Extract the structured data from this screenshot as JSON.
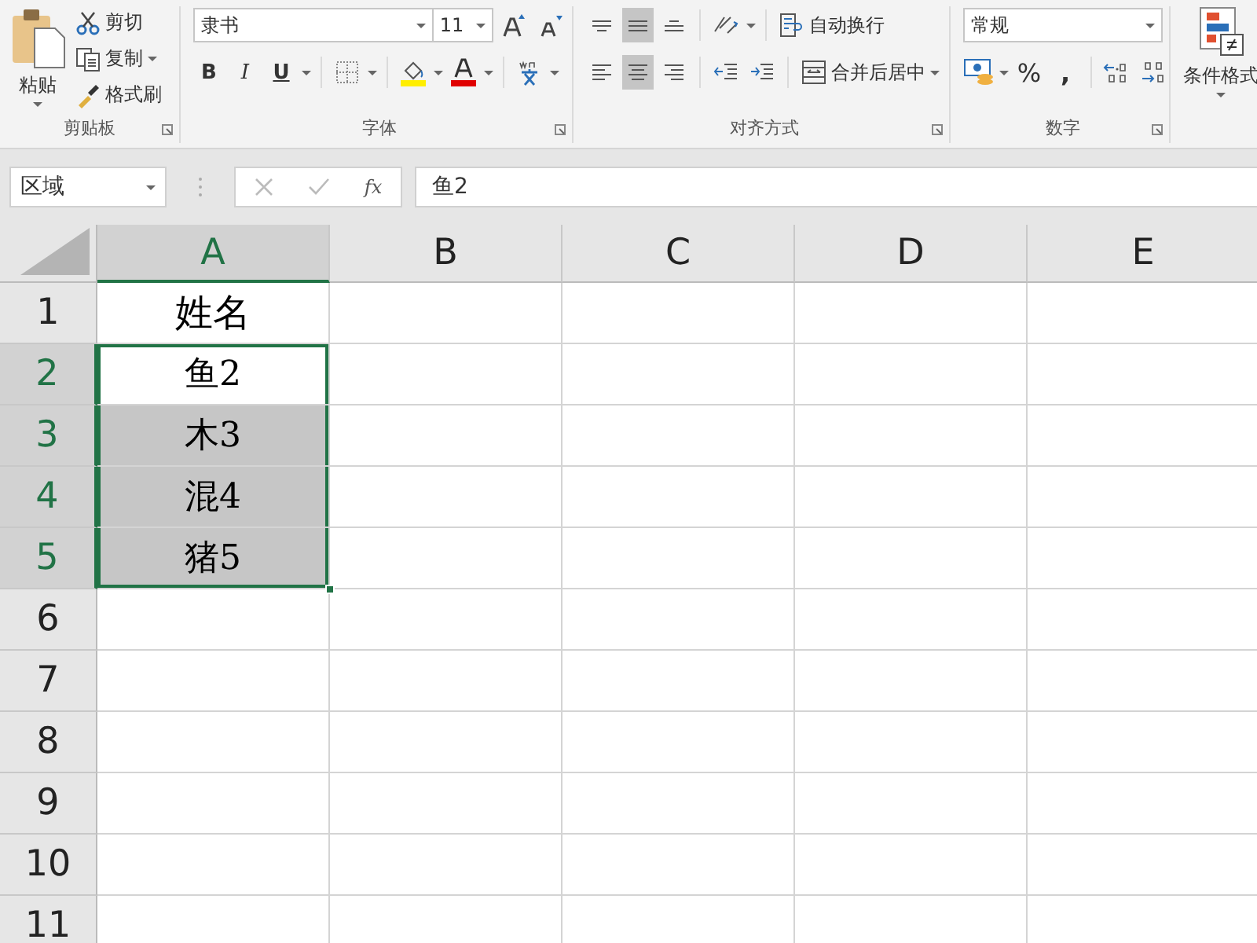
{
  "ribbon": {
    "clipboard": {
      "paste": "粘贴",
      "cut": "剪切",
      "copy": "复制",
      "format_painter": "格式刷",
      "label": "剪贴板"
    },
    "font": {
      "font_name": "隶书",
      "font_size": "11",
      "bold": "B",
      "italic": "I",
      "underline": "U",
      "label": "字体"
    },
    "alignment": {
      "vertical": [
        {
          "kind": "top",
          "selected": false
        },
        {
          "kind": "middle",
          "selected": true
        },
        {
          "kind": "bottom",
          "selected": false
        }
      ],
      "horizontal": [
        {
          "kind": "left",
          "selected": false
        },
        {
          "kind": "center",
          "selected": true
        },
        {
          "kind": "right",
          "selected": false
        }
      ],
      "wrap_text": "自动换行",
      "merge_center": "合并后居中",
      "label": "对齐方式"
    },
    "number": {
      "format": "常规",
      "percent": "%",
      "comma": ",",
      "label": "数字"
    },
    "styles": {
      "conditional_formatting": "条件格式"
    }
  },
  "formula_bar": {
    "name_box": "区域",
    "fx": "fx",
    "value": "鱼2"
  },
  "sheet": {
    "columns": [
      {
        "label": "A",
        "selected": true
      },
      {
        "label": "B",
        "selected": false
      },
      {
        "label": "C",
        "selected": false
      },
      {
        "label": "D",
        "selected": false
      },
      {
        "label": "E",
        "selected": false
      }
    ],
    "rows": [
      {
        "label": "1",
        "selected": false,
        "cell": {
          "text": "姓名",
          "selected": false,
          "active": false
        }
      },
      {
        "label": "2",
        "selected": true,
        "cell": {
          "text": "鱼2",
          "selected": true,
          "active": true
        }
      },
      {
        "label": "3",
        "selected": true,
        "cell": {
          "text": "木3",
          "selected": true,
          "active": false
        }
      },
      {
        "label": "4",
        "selected": true,
        "cell": {
          "text": "混4",
          "selected": true,
          "active": false
        }
      },
      {
        "label": "5",
        "selected": true,
        "cell": {
          "text": "猪5",
          "selected": true,
          "active": false
        }
      },
      {
        "label": "6",
        "selected": false
      },
      {
        "label": "7",
        "selected": false
      },
      {
        "label": "8",
        "selected": false
      },
      {
        "label": "9",
        "selected": false
      },
      {
        "label": "10",
        "selected": false
      },
      {
        "label": "11",
        "selected": false
      }
    ]
  }
}
